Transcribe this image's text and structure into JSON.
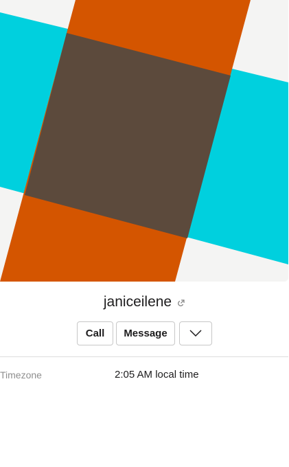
{
  "profile": {
    "username": "janiceilene",
    "external_link_icon": "external-link-icon",
    "banner_colors": {
      "background": "#f4f4f3",
      "cyan": "#00d0de",
      "orange": "#d45500",
      "overlap": "#5c4a3c"
    }
  },
  "actions": {
    "call_label": "Call",
    "message_label": "Message",
    "more_icon": "chevron-down-icon"
  },
  "fields": [
    {
      "label": "Timezone",
      "value": "2:05 AM local time"
    }
  ]
}
